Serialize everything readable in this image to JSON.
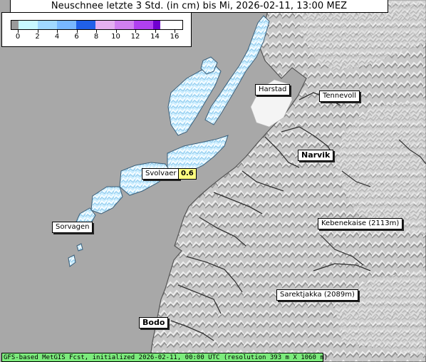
{
  "title": "Neuschnee letzte 3 Std. (in cm) bis Mi, 2026-02-11, 13:00 MEZ",
  "legend": {
    "ticks": [
      "0",
      "2",
      "4",
      "6",
      "8",
      "10",
      "12",
      "14",
      "16"
    ],
    "colors": [
      "#9a9a9a",
      "#c8f8ff",
      "#a0d8ff",
      "#78b8ff",
      "#2060e8",
      "#e4b0f0",
      "#d080f0",
      "#b040f0",
      "#7000d0"
    ]
  },
  "places": {
    "harstad": "Harstad",
    "tennevoll": "Tennevoll",
    "narvik": "Narvik",
    "svolvaer": "Svolvaer",
    "sorvagen": "Sorvagen",
    "kebnekaise": "Kebenekaise (2113m)",
    "sarektjakka": "Sarektjakka (2089m)",
    "bodo": "Bodo"
  },
  "values": {
    "svolvaer": "0.6"
  },
  "footer": "GFS-based MetGIS Fcst, initialized 2026-02-11, 00:00 UTC  (resolution 393 m X 1060 m)"
}
